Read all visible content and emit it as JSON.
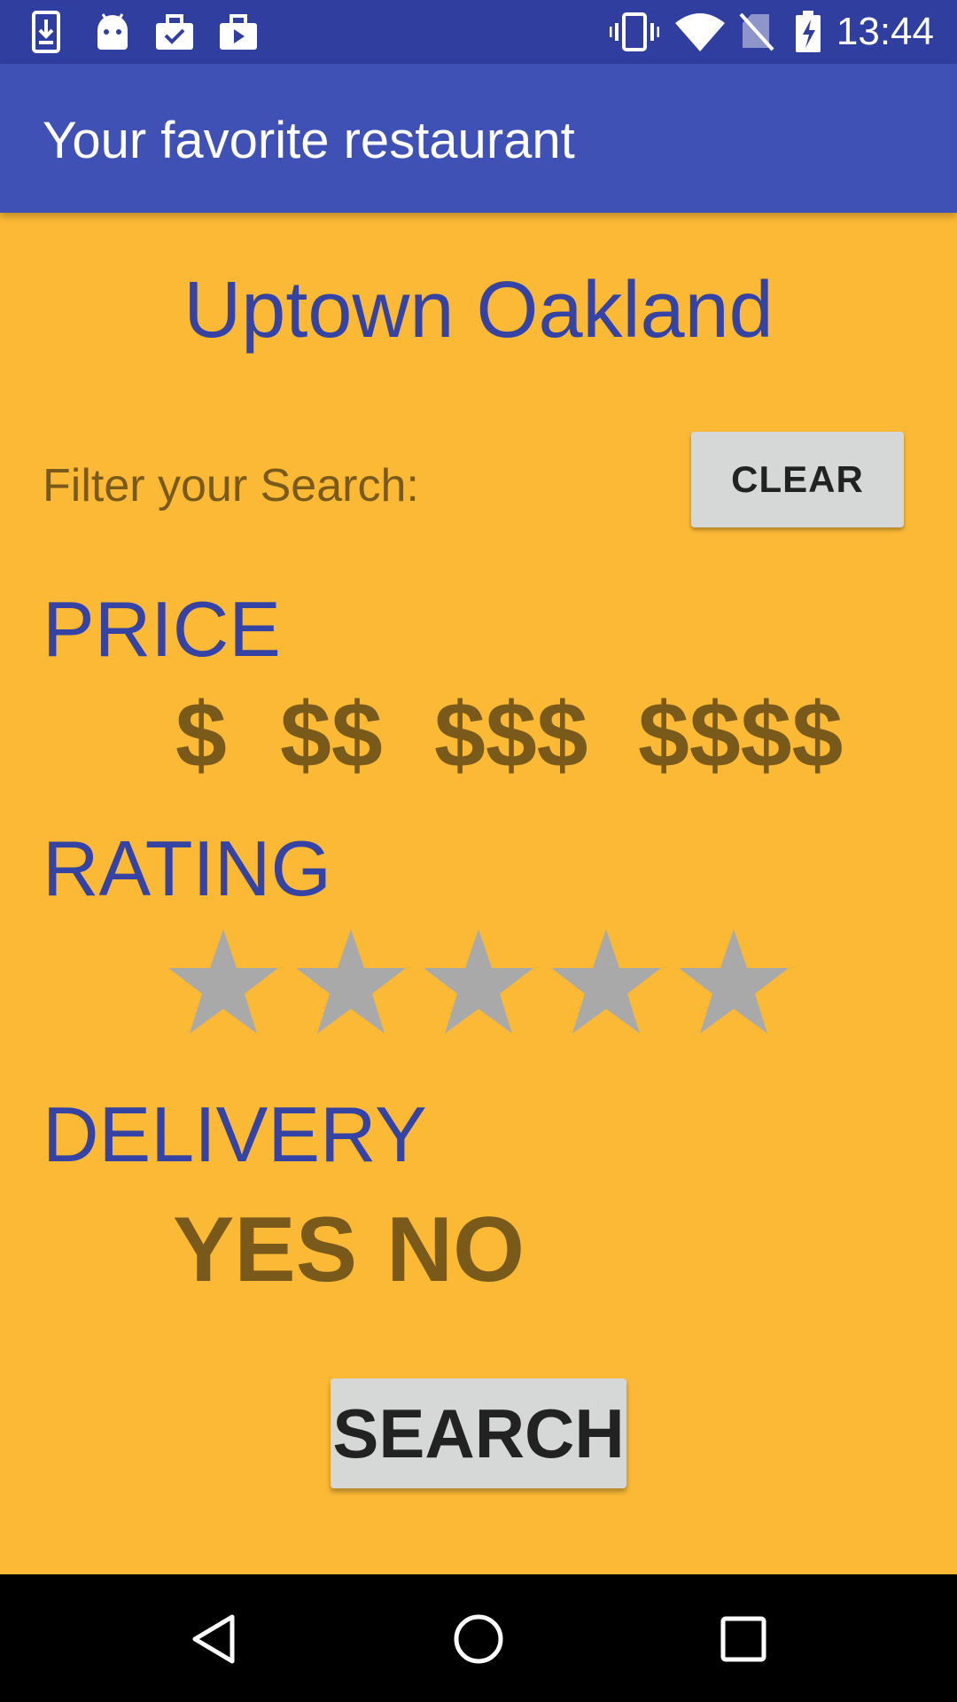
{
  "status_bar": {
    "time": "13:44",
    "icons_left": [
      "download-icon",
      "android-icon",
      "briefcase-check-icon",
      "briefcase-play-icon"
    ],
    "icons_right": [
      "vibrate-icon",
      "wifi-icon",
      "no-sim-icon",
      "battery-charging-icon"
    ]
  },
  "app_bar": {
    "title": "Your favorite restaurant",
    "color": "#3F51B5"
  },
  "main": {
    "location": "Uptown Oakland",
    "filter_label": "Filter your Search:",
    "clear_label": "CLEAR",
    "price": {
      "heading": "PRICE",
      "options": [
        "$",
        "$$",
        "$$$",
        "$$$$"
      ]
    },
    "rating": {
      "heading": "RATING",
      "selected_stars": 0,
      "max_stars": 5
    },
    "delivery": {
      "heading": "DELIVERY",
      "yes_label": "YES",
      "no_label": "NO"
    },
    "search_label": "SEARCH",
    "background_color": "#FBB935",
    "accent_color": "#3443A4"
  },
  "nav_bar": {
    "buttons": [
      "back-icon",
      "home-icon",
      "recents-icon"
    ]
  }
}
